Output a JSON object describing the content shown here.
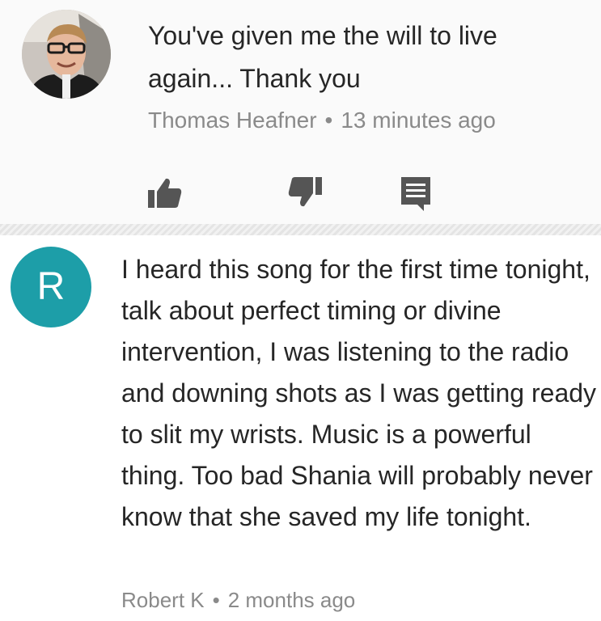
{
  "comments": [
    {
      "text": "You've given me the will to live again... Thank you",
      "author": "Thomas Heafner",
      "separator": "•",
      "time": "13 minutes ago",
      "avatar": "profile-photo",
      "actions": [
        "thumbs-up-icon",
        "thumbs-down-icon",
        "reply-icon"
      ]
    },
    {
      "text": "I heard this song for the first time tonight, talk about perfect timing or divine intervention, I was listening to the radio and downing shots as I was getting ready to slit my wrists. Music is a powerful thing. Too bad Shania will probably never know that she saved my life tonight.",
      "author": "Robert K",
      "separator": "•",
      "time": "2 months ago",
      "avatar_letter": "R",
      "avatar_color": "#1d9ea8"
    }
  ],
  "colors": {
    "text": "#262626",
    "meta": "#8a8a8a",
    "icon": "#555555",
    "first_comment_bg": "#fafafa"
  }
}
